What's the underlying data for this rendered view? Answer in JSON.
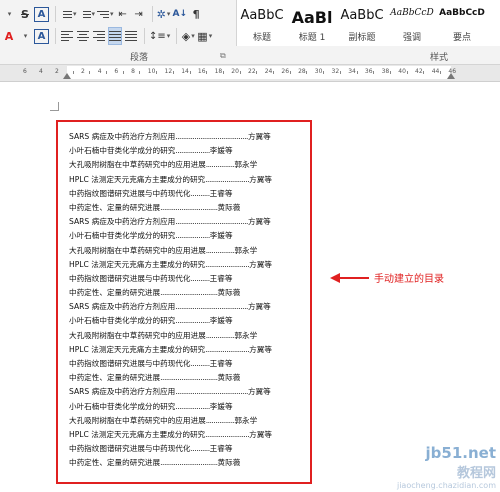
{
  "ribbon": {
    "row1": {
      "strikethrough_label": "S",
      "font_color_label": "A",
      "bullets_icon": "bullet-list-icon",
      "numbering_icon": "numbered-list-icon",
      "multilevel_icon": "multilevel-list-icon",
      "decrease_indent_icon": "decrease-indent-icon",
      "increase_indent_icon": "increase-indent-icon",
      "chinese_layout_icon": "chinese-layout-icon",
      "sort_icon": "sort-icon",
      "show_marks_label": "¶"
    },
    "row2": {
      "text_effects_label": "A",
      "font_color_label": "A",
      "align_left_icon": "align-left-icon",
      "align_center_icon": "align-center-icon",
      "align_right_icon": "align-right-icon",
      "justify_icon": "justify-icon",
      "distributed_icon": "distributed-icon",
      "line_spacing_icon": "line-spacing-icon",
      "shading_icon": "shading-icon",
      "borders_icon": "borders-icon"
    },
    "paragraph_group_label": "段落",
    "styles_group_label": "样式",
    "styles": [
      {
        "sample": "AaBbC",
        "name": "标题"
      },
      {
        "sample": "AaBl",
        "name": "标题 1"
      },
      {
        "sample": "AaBbC",
        "name": "副标题"
      },
      {
        "sample": "AaBbCcD",
        "name": "强调"
      },
      {
        "sample": "AaBbCcD",
        "name": "要点"
      }
    ],
    "colors": {
      "accent": "#2b579a",
      "font_red": "#e02020",
      "highlight": "#e02020"
    }
  },
  "ruler": {
    "left_labels": [
      "6",
      "4",
      "2"
    ],
    "right_labels": [
      "2",
      "4",
      "6",
      "8",
      "10",
      "12",
      "14",
      "16",
      "18",
      "20",
      "22",
      "24",
      "26",
      "28",
      "30",
      "32",
      "34",
      "36",
      "38",
      "40",
      "42",
      "44",
      "46"
    ]
  },
  "toc": {
    "entries": [
      {
        "title": "SARS 病症及中药治疗方剂应用",
        "dots": "......................................",
        "author": "方翼等"
      },
      {
        "title": "小叶石楠中苷类化学成分的研究",
        "dots": "..................",
        "author": "李媛等"
      },
      {
        "title": "大孔吸附树脂在中草药研究中的应用进展",
        "dots": "...............",
        "author": "郭永学"
      },
      {
        "title": "HPLC 法测定天元克痛方主要成分的研究",
        "dots": ".......................",
        "author": "方翼等"
      },
      {
        "title": "中药指纹图谱研究进展与中药现代化",
        "dots": "..........",
        "author": "王睿等"
      },
      {
        "title": "中药定性、定量的研究进展",
        "dots": "..............................",
        "author": "黄际薇"
      },
      {
        "title": "SARS 病症及中药治疗方剂应用",
        "dots": "......................................",
        "author": "方翼等"
      },
      {
        "title": "小叶石楠中苷类化学成分的研究",
        "dots": "..................",
        "author": "李媛等"
      },
      {
        "title": "大孔吸附树脂在中草药研究中的应用进展",
        "dots": "...............",
        "author": "郭永学"
      },
      {
        "title": "HPLC 法测定天元克痛方主要成分的研究",
        "dots": ".......................",
        "author": "方翼等"
      },
      {
        "title": "中药指纹图谱研究进展与中药现代化",
        "dots": "..........",
        "author": "王睿等"
      },
      {
        "title": "中药定性、定量的研究进展",
        "dots": "..............................",
        "author": "黄际薇"
      },
      {
        "title": "SARS 病症及中药治疗方剂应用",
        "dots": "......................................",
        "author": "方翼等"
      },
      {
        "title": "小叶石楠中苷类化学成分的研究",
        "dots": "..................",
        "author": "李媛等"
      },
      {
        "title": "大孔吸附树脂在中草药研究中的应用进展",
        "dots": "...............",
        "author": "郭永学"
      },
      {
        "title": "HPLC 法测定天元克痛方主要成分的研究",
        "dots": ".......................",
        "author": "方翼等"
      },
      {
        "title": "中药指纹图谱研究进展与中药现代化",
        "dots": "..........",
        "author": "王睿等"
      },
      {
        "title": "中药定性、定量的研究进展",
        "dots": "..............................",
        "author": "黄际薇"
      },
      {
        "title": "SARS 病症及中药治疗方剂应用",
        "dots": "......................................",
        "author": "方翼等"
      },
      {
        "title": "小叶石楠中苷类化学成分的研究",
        "dots": "..................",
        "author": "李媛等"
      },
      {
        "title": "大孔吸附树脂在中草药研究中的应用进展",
        "dots": "...............",
        "author": "郭永学"
      },
      {
        "title": "HPLC 法测定天元克痛方主要成分的研究",
        "dots": ".......................",
        "author": "方翼等"
      },
      {
        "title": "中药指纹图谱研究进展与中药现代化",
        "dots": "..........",
        "author": "王睿等"
      },
      {
        "title": "中药定性、定量的研究进展",
        "dots": "..............................",
        "author": "黄际薇"
      }
    ],
    "border_color": "#e02020"
  },
  "annotation": {
    "text": "手动建立的目录"
  },
  "watermark": {
    "domain": "jb51.net",
    "cn": "教程网",
    "sub": "jiaocheng.chazidian.com"
  }
}
